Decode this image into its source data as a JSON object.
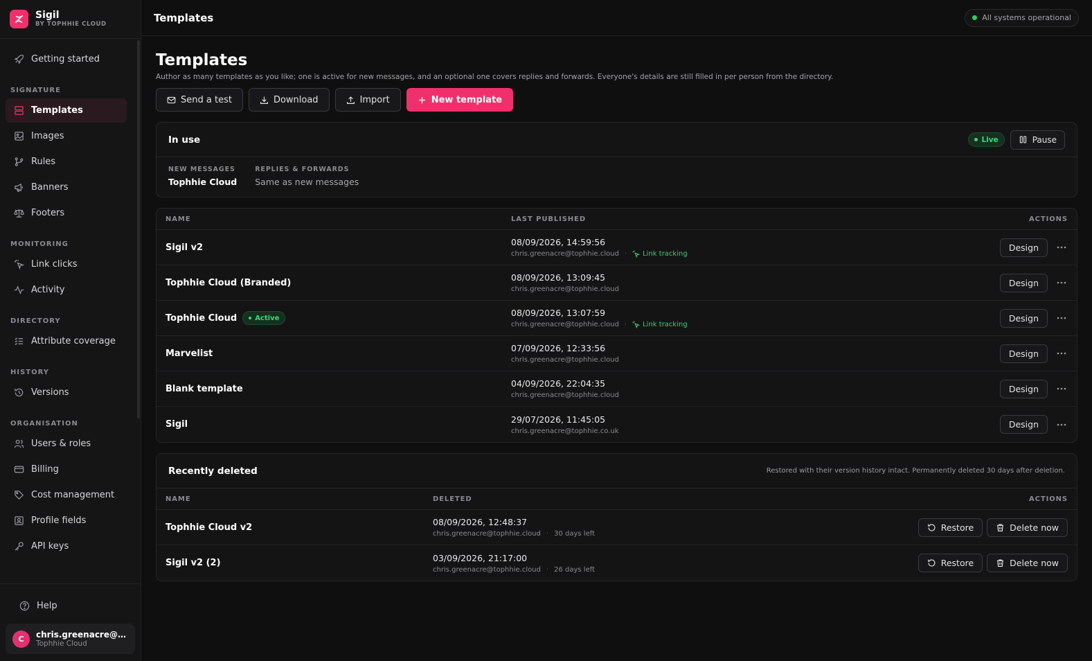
{
  "brand": {
    "name": "Sigil",
    "subtitle": "BY TOPHHIE CLOUD"
  },
  "sidebar": {
    "getting_started": "Getting started",
    "sections": [
      {
        "title": "SIGNATURE",
        "items": [
          {
            "label": "Templates",
            "icon": "layout-icon",
            "active": true
          },
          {
            "label": "Images",
            "icon": "image-icon"
          },
          {
            "label": "Rules",
            "icon": "branch-icon"
          },
          {
            "label": "Banners",
            "icon": "megaphone-icon"
          },
          {
            "label": "Footers",
            "icon": "scale-icon"
          }
        ]
      },
      {
        "title": "MONITORING",
        "items": [
          {
            "label": "Link clicks",
            "icon": "cursor-click-icon"
          },
          {
            "label": "Activity",
            "icon": "activity-icon"
          }
        ]
      },
      {
        "title": "DIRECTORY",
        "items": [
          {
            "label": "Attribute coverage",
            "icon": "list-check-icon"
          }
        ]
      },
      {
        "title": "HISTORY",
        "items": [
          {
            "label": "Versions",
            "icon": "history-icon"
          }
        ]
      },
      {
        "title": "ORGANISATION",
        "items": [
          {
            "label": "Users & roles",
            "icon": "users-icon"
          },
          {
            "label": "Billing",
            "icon": "card-icon"
          },
          {
            "label": "Cost management",
            "icon": "tag-icon"
          },
          {
            "label": "Profile fields",
            "icon": "id-card-icon"
          },
          {
            "label": "API keys",
            "icon": "key-icon"
          }
        ]
      }
    ],
    "help": "Help",
    "user": {
      "initial": "C",
      "email": "chris.greenacre@tophhie.cloud",
      "org": "Tophhie Cloud"
    }
  },
  "topbar": {
    "title": "Templates",
    "status": "All systems operational"
  },
  "page": {
    "title": "Templates",
    "description": "Author as many templates as you like; one is active for new messages, and an optional one covers replies and forwards. Everyone's details are still filled in per person from the directory."
  },
  "toolbar": {
    "send_test": "Send a test",
    "download": "Download",
    "import": "Import",
    "new_template": "New template"
  },
  "in_use": {
    "title": "In use",
    "live": "Live",
    "pause": "Pause",
    "new_messages_label": "NEW MESSAGES",
    "new_messages_value": "Tophhie Cloud",
    "replies_label": "REPLIES & FORWARDS",
    "replies_value": "Same as new messages"
  },
  "templates": {
    "headers": {
      "name": "NAME",
      "last_published": "LAST PUBLISHED",
      "actions": "ACTIONS"
    },
    "design_label": "Design",
    "link_tracking_label": "Link tracking",
    "active_label": "Active",
    "rows": [
      {
        "name": "Sigil v2",
        "date": "08/09/2026, 14:59:56",
        "by": "chris.greenacre@tophhie.cloud",
        "link_tracking": true,
        "active": false
      },
      {
        "name": "Tophhie Cloud (Branded)",
        "date": "08/09/2026, 13:09:45",
        "by": "chris.greenacre@tophhie.cloud",
        "link_tracking": false,
        "active": false
      },
      {
        "name": "Tophhie Cloud",
        "date": "08/09/2026, 13:07:59",
        "by": "chris.greenacre@tophhie.cloud",
        "link_tracking": true,
        "active": true
      },
      {
        "name": "Marvelist",
        "date": "07/09/2026, 12:33:56",
        "by": "chris.greenacre@tophhie.cloud",
        "link_tracking": false,
        "active": false
      },
      {
        "name": "Blank template",
        "date": "04/09/2026, 22:04:35",
        "by": "chris.greenacre@tophhie.cloud",
        "link_tracking": false,
        "active": false
      },
      {
        "name": "Sigil",
        "date": "29/07/2026, 11:45:05",
        "by": "chris.greenacre@tophhie.co.uk",
        "link_tracking": false,
        "active": false
      }
    ]
  },
  "deleted": {
    "title": "Recently deleted",
    "note": "Restored with their version history intact. Permanently deleted 30 days after deletion.",
    "headers": {
      "name": "NAME",
      "deleted": "DELETED",
      "actions": "ACTIONS"
    },
    "restore_label": "Restore",
    "delete_now_label": "Delete now",
    "rows": [
      {
        "name": "Tophhie Cloud v2",
        "date": "08/09/2026, 12:48:37",
        "by": "chris.greenacre@tophhie.cloud",
        "left": "30 days left"
      },
      {
        "name": "Sigil v2 (2)",
        "date": "03/09/2026, 21:17:00",
        "by": "chris.greenacre@tophhie.cloud",
        "left": "26 days left"
      }
    ]
  },
  "colors": {
    "accent": "#f0306c",
    "success": "#38d977",
    "background": "#0f0f10",
    "sidebar": "#151516"
  }
}
